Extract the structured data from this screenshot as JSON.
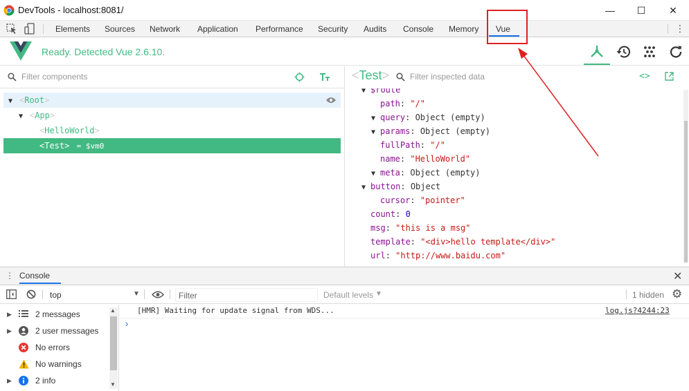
{
  "window": {
    "title": "DevTools - localhost:8081/",
    "controls": {
      "minimize": "—",
      "maximize": "☐",
      "close": "✕"
    }
  },
  "devtools_tabs": [
    "Elements",
    "Sources",
    "Network",
    "Application",
    "Performance",
    "Security",
    "Audits",
    "Console",
    "Memory",
    "Vue"
  ],
  "active_tab": "Vue",
  "vue_header": {
    "status": "Ready. Detected Vue 2.6.10.",
    "accent": "#42b983"
  },
  "components": {
    "filter_placeholder": "Filter components",
    "tree": [
      {
        "name": "Root",
        "depth": 0,
        "expanded": true
      },
      {
        "name": "App",
        "depth": 1,
        "expanded": true
      },
      {
        "name": "HelloWorld",
        "depth": 2
      },
      {
        "name": "Test",
        "depth": 2,
        "selected": true,
        "vm_ref": "= $vm0"
      }
    ]
  },
  "inspector": {
    "component": "Test",
    "filter_placeholder": "Filter inspected data",
    "props": [
      {
        "indent": 1,
        "toggle": "▼",
        "key": "$route",
        "sep": "",
        "value": "",
        "kind": "plain"
      },
      {
        "indent": 2,
        "toggle": "",
        "key": "path",
        "sep": ": ",
        "value": "\"/\"",
        "kind": "str"
      },
      {
        "indent": 2,
        "toggle": "▼",
        "key": "query",
        "sep": ": ",
        "value": "Object (empty)",
        "kind": "plain"
      },
      {
        "indent": 2,
        "toggle": "▼",
        "key": "params",
        "sep": ": ",
        "value": "Object (empty)",
        "kind": "plain"
      },
      {
        "indent": 2,
        "toggle": "",
        "key": "fullPath",
        "sep": ": ",
        "value": "\"/\"",
        "kind": "str"
      },
      {
        "indent": 2,
        "toggle": "",
        "key": "name",
        "sep": ": ",
        "value": "\"HelloWorld\"",
        "kind": "str"
      },
      {
        "indent": 2,
        "toggle": "▼",
        "key": "meta",
        "sep": ": ",
        "value": "Object (empty)",
        "kind": "plain"
      },
      {
        "indent": 1,
        "toggle": "▼",
        "key": "button",
        "sep": ": ",
        "value": "Object",
        "kind": "plain"
      },
      {
        "indent": 2,
        "toggle": "",
        "key": "cursor",
        "sep": ": ",
        "value": "\"pointer\"",
        "kind": "str"
      },
      {
        "indent": 1,
        "toggle": "",
        "key": "count",
        "sep": ": ",
        "value": "0",
        "kind": "num"
      },
      {
        "indent": 1,
        "toggle": "",
        "key": "msg",
        "sep": ": ",
        "value": "\"this is a msg\"",
        "kind": "str"
      },
      {
        "indent": 1,
        "toggle": "",
        "key": "template",
        "sep": ": ",
        "value": "\"<div>hello template</div>\"",
        "kind": "str"
      },
      {
        "indent": 1,
        "toggle": "",
        "key": "url",
        "sep": ": ",
        "value": "\"http://www.baidu.com\"",
        "kind": "str"
      }
    ]
  },
  "console": {
    "tab": "Console",
    "context": "top",
    "filter_placeholder": "Filter",
    "levels": "Default levels",
    "hidden": "1 hidden",
    "sidebar": [
      {
        "label": "2 messages",
        "icon": "list-icon"
      },
      {
        "label": "2 user messages",
        "icon": "user-icon"
      },
      {
        "label": "No errors",
        "icon": "error-icon"
      },
      {
        "label": "No warnings",
        "icon": "warning-icon"
      },
      {
        "label": "2 info",
        "icon": "info-icon"
      }
    ],
    "log_message": "[HMR] Waiting for update signal from WDS...",
    "log_source": "log.js?4244:23",
    "prompt": "›"
  }
}
